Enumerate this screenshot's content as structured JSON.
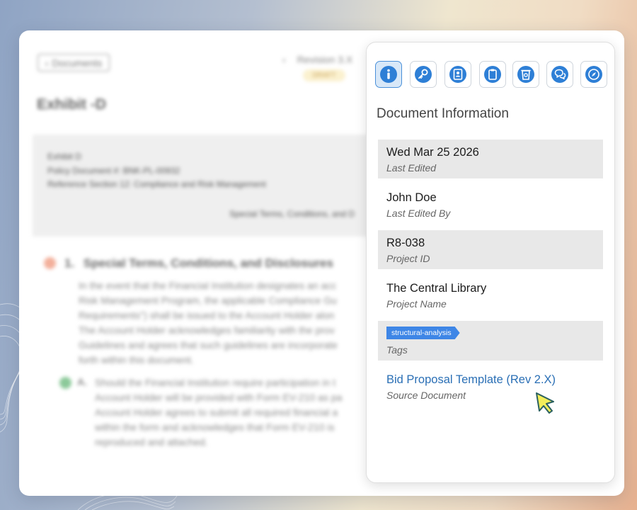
{
  "document": {
    "back_label": "Documents",
    "revision": "Revision 3.X",
    "status": "DRAFT",
    "title": "Exhibit -D",
    "header_lines": [
      "Exhibit D",
      "Policy Document #: BNK-PL-00932",
      "Reference Section 12: Compliance and Risk Management"
    ],
    "header_center": "Special Terms, Conditions, and D",
    "section_number": "1.",
    "section_title": "Special Terms, Conditions, and Disclosures",
    "section_body": "In the event that the Financial Institution designates an acc\nRisk Management Program, the applicable Compliance Gu\nRequirements\") shall be issued to the Account Holder alon\nThe Account Holder acknowledges familiarity with the prov\nGuidelines and agrees that such guidelines are incorporate\nforth within this document.",
    "sub_label": "A.",
    "sub_body": "Should the Financial Institution require participation in t\nAccount Holder will be provided with Form EV-210 as pa\nAccount Holder agrees to submit all required financial a\nwithin the form and acknowledges that Form EV-210 is\nreproduced and attached."
  },
  "panel": {
    "title": "Document Information",
    "icons": [
      "info-icon",
      "key-icon",
      "id-card-icon",
      "clipboard-icon",
      "trash-icon",
      "chat-icon",
      "compass-icon"
    ],
    "fields": [
      {
        "value": "Wed Mar 25 2026",
        "label": "Last Edited"
      },
      {
        "value": "John Doe",
        "label": "Last Edited By"
      },
      {
        "value": "R8-038",
        "label": "Project ID"
      },
      {
        "value": "The Central Library",
        "label": "Project Name"
      },
      {
        "tag": "structural-analysis",
        "label": "Tags"
      },
      {
        "value": "Bid Proposal Template (Rev 2.X)",
        "label": "Source Document"
      }
    ]
  },
  "colors": {
    "accent": "#2a6fb5",
    "icon_blue": "#2e7fd6",
    "tag_bg": "#3e86e6",
    "active_icon_bg": "#d8e8f8",
    "cursor_fill": "#f4ee5a"
  }
}
